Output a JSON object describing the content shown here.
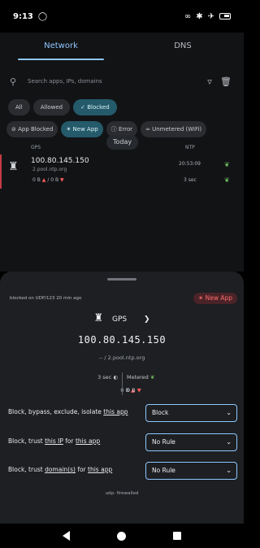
{
  "status_bar": {
    "time": "9:13",
    "left_icon": "whatsapp-icon",
    "right_icons": [
      "link-icon",
      "wifi-off-icon",
      "airplane-icon",
      "battery-icon"
    ]
  },
  "tabs": [
    {
      "label": "Network",
      "active": true
    },
    {
      "label": "DNS",
      "active": false
    }
  ],
  "search": {
    "placeholder": "Search apps, IPs, domains",
    "icons": [
      "search-icon",
      "filter-icon",
      "trash-icon"
    ]
  },
  "filter_chips": [
    {
      "label": "All"
    },
    {
      "label": "Allowed"
    },
    {
      "label": "✓ Blocked",
      "selected": true
    }
  ],
  "tag_chips": [
    {
      "label": "App Blocked"
    },
    {
      "label": "New App",
      "selected": true
    },
    {
      "label": "Error"
    },
    {
      "label": "Unmetered (WiFi)"
    }
  ],
  "log": {
    "date_header": "Today",
    "col_left": "GPS",
    "col_right": "NTP",
    "row": {
      "ip": "100.80.145.150",
      "host": "2.pool.ntp.org",
      "bytes_out": "0 B",
      "bytes_sep": "·",
      "bytes_in": "/ 0 B",
      "time": "20:53:09",
      "duration": "3 sec"
    }
  },
  "sheet": {
    "blocked_on": "blocked on UDP/123 20 min ago",
    "badge": "New App",
    "app_name": "GPS",
    "ip": "100.80.145.150",
    "host": "-- / 2.pool.ntp.org",
    "duration": "3 sec",
    "metered": "Metered",
    "sent": "0 B",
    "received": "0 B",
    "rules": [
      {
        "text": "Block, bypass, exclude, isolate",
        "link": "this app",
        "pre_link": "",
        "post_link": "",
        "value": "Block"
      },
      {
        "text": "Block, trust",
        "link": "this IP",
        "post_text": "for",
        "link2": "this app",
        "value": "No Rule"
      },
      {
        "text": "Block, trust",
        "link": "domain(s)",
        "post_text": "for",
        "link2": "this app",
        "value": "No Rule"
      }
    ],
    "footer": "udp: firewalled"
  },
  "colors": {
    "accent": "#8fc7ff",
    "blocked_red": "#c43b45",
    "badge_red": "#ff6b6b",
    "chip_selected": "#245a6a"
  }
}
